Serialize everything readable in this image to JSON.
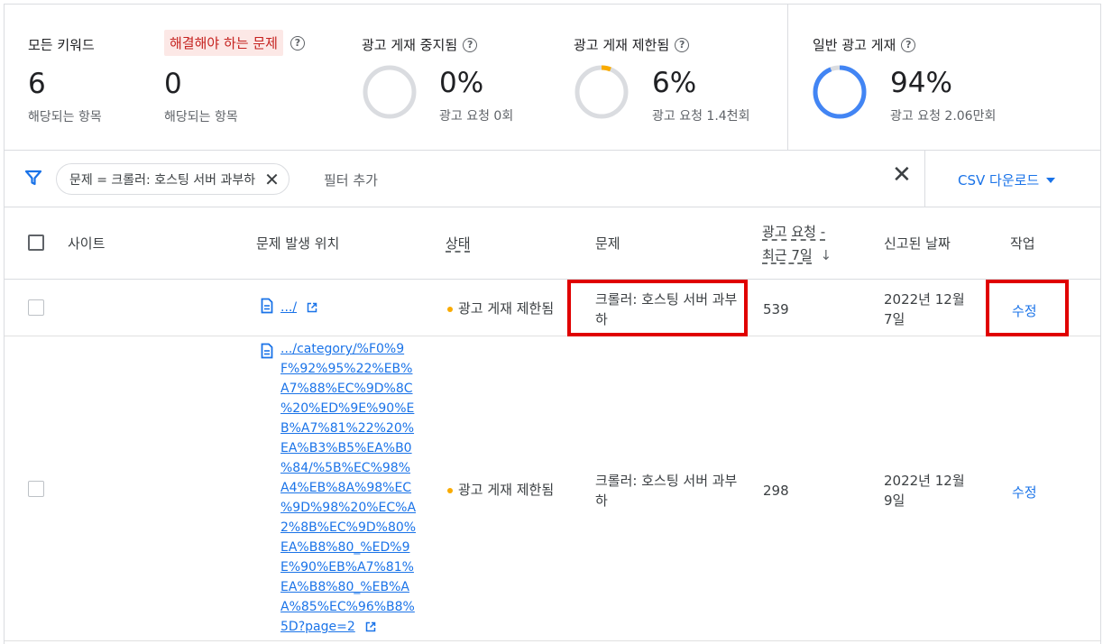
{
  "summary": {
    "all_keywords": {
      "label": "모든 키워드",
      "value": "6",
      "sub": "해당되는 항목"
    },
    "issues": {
      "label": "해결해야 하는 문제",
      "value": "0",
      "sub": "해당되는 항목"
    },
    "ads_stopped": {
      "label": "광고 게재 중지됨",
      "value": "0%",
      "sub": "광고 요청 0회",
      "fraction": 0
    },
    "ads_limited": {
      "label": "광고 게재 제한됨",
      "value": "6%",
      "sub": "광고 요청 1.4천회",
      "fraction": 0.06
    },
    "ads_normal": {
      "label": "일반 광고 게재",
      "value": "94%",
      "sub": "광고 요청 2.06만회",
      "fraction": 0.94
    },
    "help_glyph": "?"
  },
  "filter": {
    "chip_label": "문제 = 크롤러: 호스팅 서버 과부하",
    "add_filter": "필터 추가",
    "csv_label": "CSV 다운로드"
  },
  "table": {
    "headers": {
      "site": "사이트",
      "location": "문제 발생 위치",
      "status": "상태",
      "issue": "문제",
      "requests_line1": "광고 요청 -",
      "requests_line2": "최근 7일",
      "reported": "신고된 날짜",
      "action": "작업"
    },
    "rows": [
      {
        "url": ".../",
        "status": "광고 게재 제한됨",
        "issue": "크롤러: 호스팅 서버 과부하",
        "requests": "539",
        "date": "2022년 12월 7일",
        "action": "수정"
      },
      {
        "url_lines": [
          ".../category/%F0%9",
          "F%92%95%22%EB%",
          "A7%88%EC%9D%8C",
          "%20%ED%9E%90%E",
          "B%A7%81%22%20%",
          "EA%B3%B5%EA%B0",
          "%84/%5B%EC%98%",
          "A4%EB%8A%98%EC",
          "%9D%98%20%EC%A",
          "2%8B%EC%9D%80%",
          "EA%B8%80_%ED%9",
          "E%90%EB%A7%81%",
          "EA%B8%80_%EB%A",
          "A%85%EC%96%B8%",
          "5D?page=2"
        ],
        "status": "광고 게재 제한됨",
        "issue": "크롤러: 호스팅 서버 과부하",
        "requests": "298",
        "date": "2022년 12월 9일",
        "action": "수정"
      }
    ]
  },
  "colors": {
    "accent": "#1a73e8",
    "warning": "#f9ab00",
    "highlight": "#e00000",
    "donut_track": "#dadce0"
  }
}
